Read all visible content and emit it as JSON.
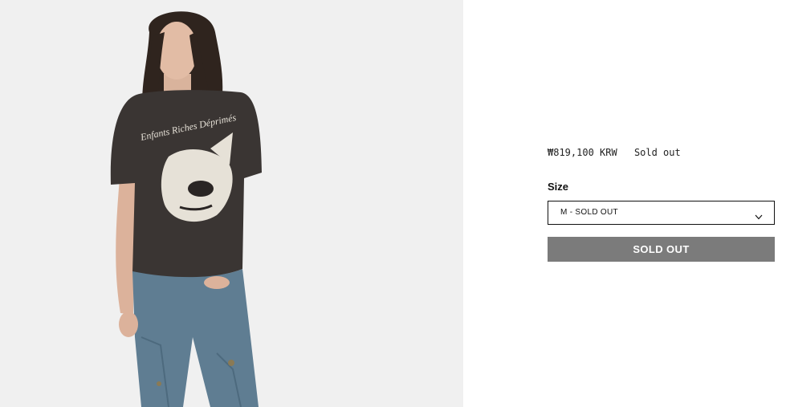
{
  "product": {
    "image": {
      "alt": "Model wearing a faded black graphic t-shirt with distressed blue jeans",
      "graphic_text": "Enfants Riches Déprimés"
    },
    "price": "₩819,100 KRW",
    "stock_status": "Sold out",
    "size_label": "Size",
    "size_selected": "M - SOLD OUT",
    "button_label": "SOLD OUT"
  },
  "colors": {
    "image_background": "#f0f0f0",
    "shirt": "#3a3533",
    "jeans": "#5f7d92",
    "button_disabled": "#7b7b7b"
  }
}
